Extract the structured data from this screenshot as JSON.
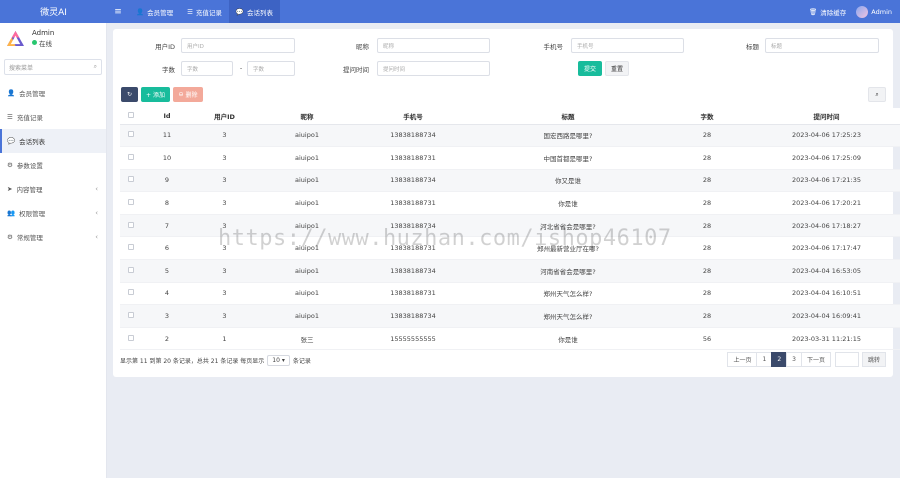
{
  "app": {
    "brand": "微灵AI"
  },
  "topbar": {
    "tabs": [
      {
        "icon": "user-icon",
        "label": "会员管理",
        "active": false
      },
      {
        "icon": "database-icon",
        "label": "充值记录",
        "active": false
      },
      {
        "icon": "chat-icon",
        "label": "会话列表",
        "active": true
      }
    ],
    "clear_cache": "清除缓存",
    "admin": "Admin"
  },
  "sidebar": {
    "user_name": "Admin",
    "status": "在线",
    "search_placeholder": "搜索菜单",
    "items": [
      {
        "icon": "user-icon",
        "label": "会员管理",
        "active": false,
        "expandable": false
      },
      {
        "icon": "database-icon",
        "label": "充值记录",
        "active": false,
        "expandable": false
      },
      {
        "icon": "chat-icon",
        "label": "会话列表",
        "active": true,
        "expandable": false
      },
      {
        "icon": "cogs-icon",
        "label": "参数设置",
        "active": false,
        "expandable": false
      },
      {
        "icon": "send-icon",
        "label": "内容管理",
        "active": false,
        "expandable": true
      },
      {
        "icon": "users-icon",
        "label": "权限管理",
        "active": false,
        "expandable": true
      },
      {
        "icon": "cog-icon",
        "label": "常规管理",
        "active": false,
        "expandable": true
      }
    ]
  },
  "filters": {
    "user_id_label": "用户ID",
    "user_id_placeholder": "用户ID",
    "nickname_label": "昵称",
    "nickname_placeholder": "昵称",
    "phone_label": "手机号",
    "phone_placeholder": "手机号",
    "title_label": "标题",
    "title_placeholder": "标题",
    "words_label": "字数",
    "words_min_placeholder": "字数",
    "range_sep": "-",
    "words_max_placeholder": "字数",
    "time_label": "提问时间",
    "time_placeholder": "提问时间",
    "submit": "提交",
    "reset": "重置"
  },
  "toolbar": {
    "add": "+ 添加",
    "delete": "删除"
  },
  "table": {
    "columns": [
      "Id",
      "用户ID",
      "昵称",
      "手机号",
      "标题",
      "字数",
      "提问时间"
    ],
    "rows": [
      {
        "id": "11",
        "uid": "3",
        "nick": "aiuipo1",
        "phone": "13838188734",
        "title": "国宏西路是哪里?",
        "words": "28",
        "time": "2023-04-06 17:25:23"
      },
      {
        "id": "10",
        "uid": "3",
        "nick": "aiuipo1",
        "phone": "13838188731",
        "title": "中国首都是哪里?",
        "words": "28",
        "time": "2023-04-06 17:25:09"
      },
      {
        "id": "9",
        "uid": "3",
        "nick": "aiuipo1",
        "phone": "13838188734",
        "title": "你又是谁",
        "words": "28",
        "time": "2023-04-06 17:21:35"
      },
      {
        "id": "8",
        "uid": "3",
        "nick": "aiuipo1",
        "phone": "13838188731",
        "title": "你是谁",
        "words": "28",
        "time": "2023-04-06 17:20:21"
      },
      {
        "id": "7",
        "uid": "3",
        "nick": "aiuipo1",
        "phone": "13838188734",
        "title": "河北省省会是哪里?",
        "words": "28",
        "time": "2023-04-06 17:18:27"
      },
      {
        "id": "6",
        "uid": "3",
        "nick": "aiuipo1",
        "phone": "13838188731",
        "title": "郑州最新营业厅在哪?",
        "words": "28",
        "time": "2023-04-06 17:17:47"
      },
      {
        "id": "5",
        "uid": "3",
        "nick": "aiuipo1",
        "phone": "13838188734",
        "title": "河南省省会是哪里?",
        "words": "28",
        "time": "2023-04-04 16:53:05"
      },
      {
        "id": "4",
        "uid": "3",
        "nick": "aiuipo1",
        "phone": "13838188731",
        "title": "郑州天气怎么样?",
        "words": "28",
        "time": "2023-04-04 16:10:51"
      },
      {
        "id": "3",
        "uid": "3",
        "nick": "aiuipo1",
        "phone": "13838188734",
        "title": "郑州天气怎么样?",
        "words": "28",
        "time": "2023-04-04 16:09:41"
      },
      {
        "id": "2",
        "uid": "1",
        "nick": "张三",
        "phone": "15555555555",
        "title": "你是谁",
        "words": "56",
        "time": "2023-03-31 11:21:15"
      }
    ]
  },
  "footer": {
    "info_prefix": "显示第 11 到第 20 条记录，总共 21 条记录 每页显示",
    "page_size": "10",
    "info_suffix": "条记录",
    "prev": "上一页",
    "pages": [
      "1",
      "2",
      "3"
    ],
    "current_page": "2",
    "next": "下一页",
    "jump": "跳转"
  },
  "watermark": "https://www.huzhan.com/ishop46107"
}
